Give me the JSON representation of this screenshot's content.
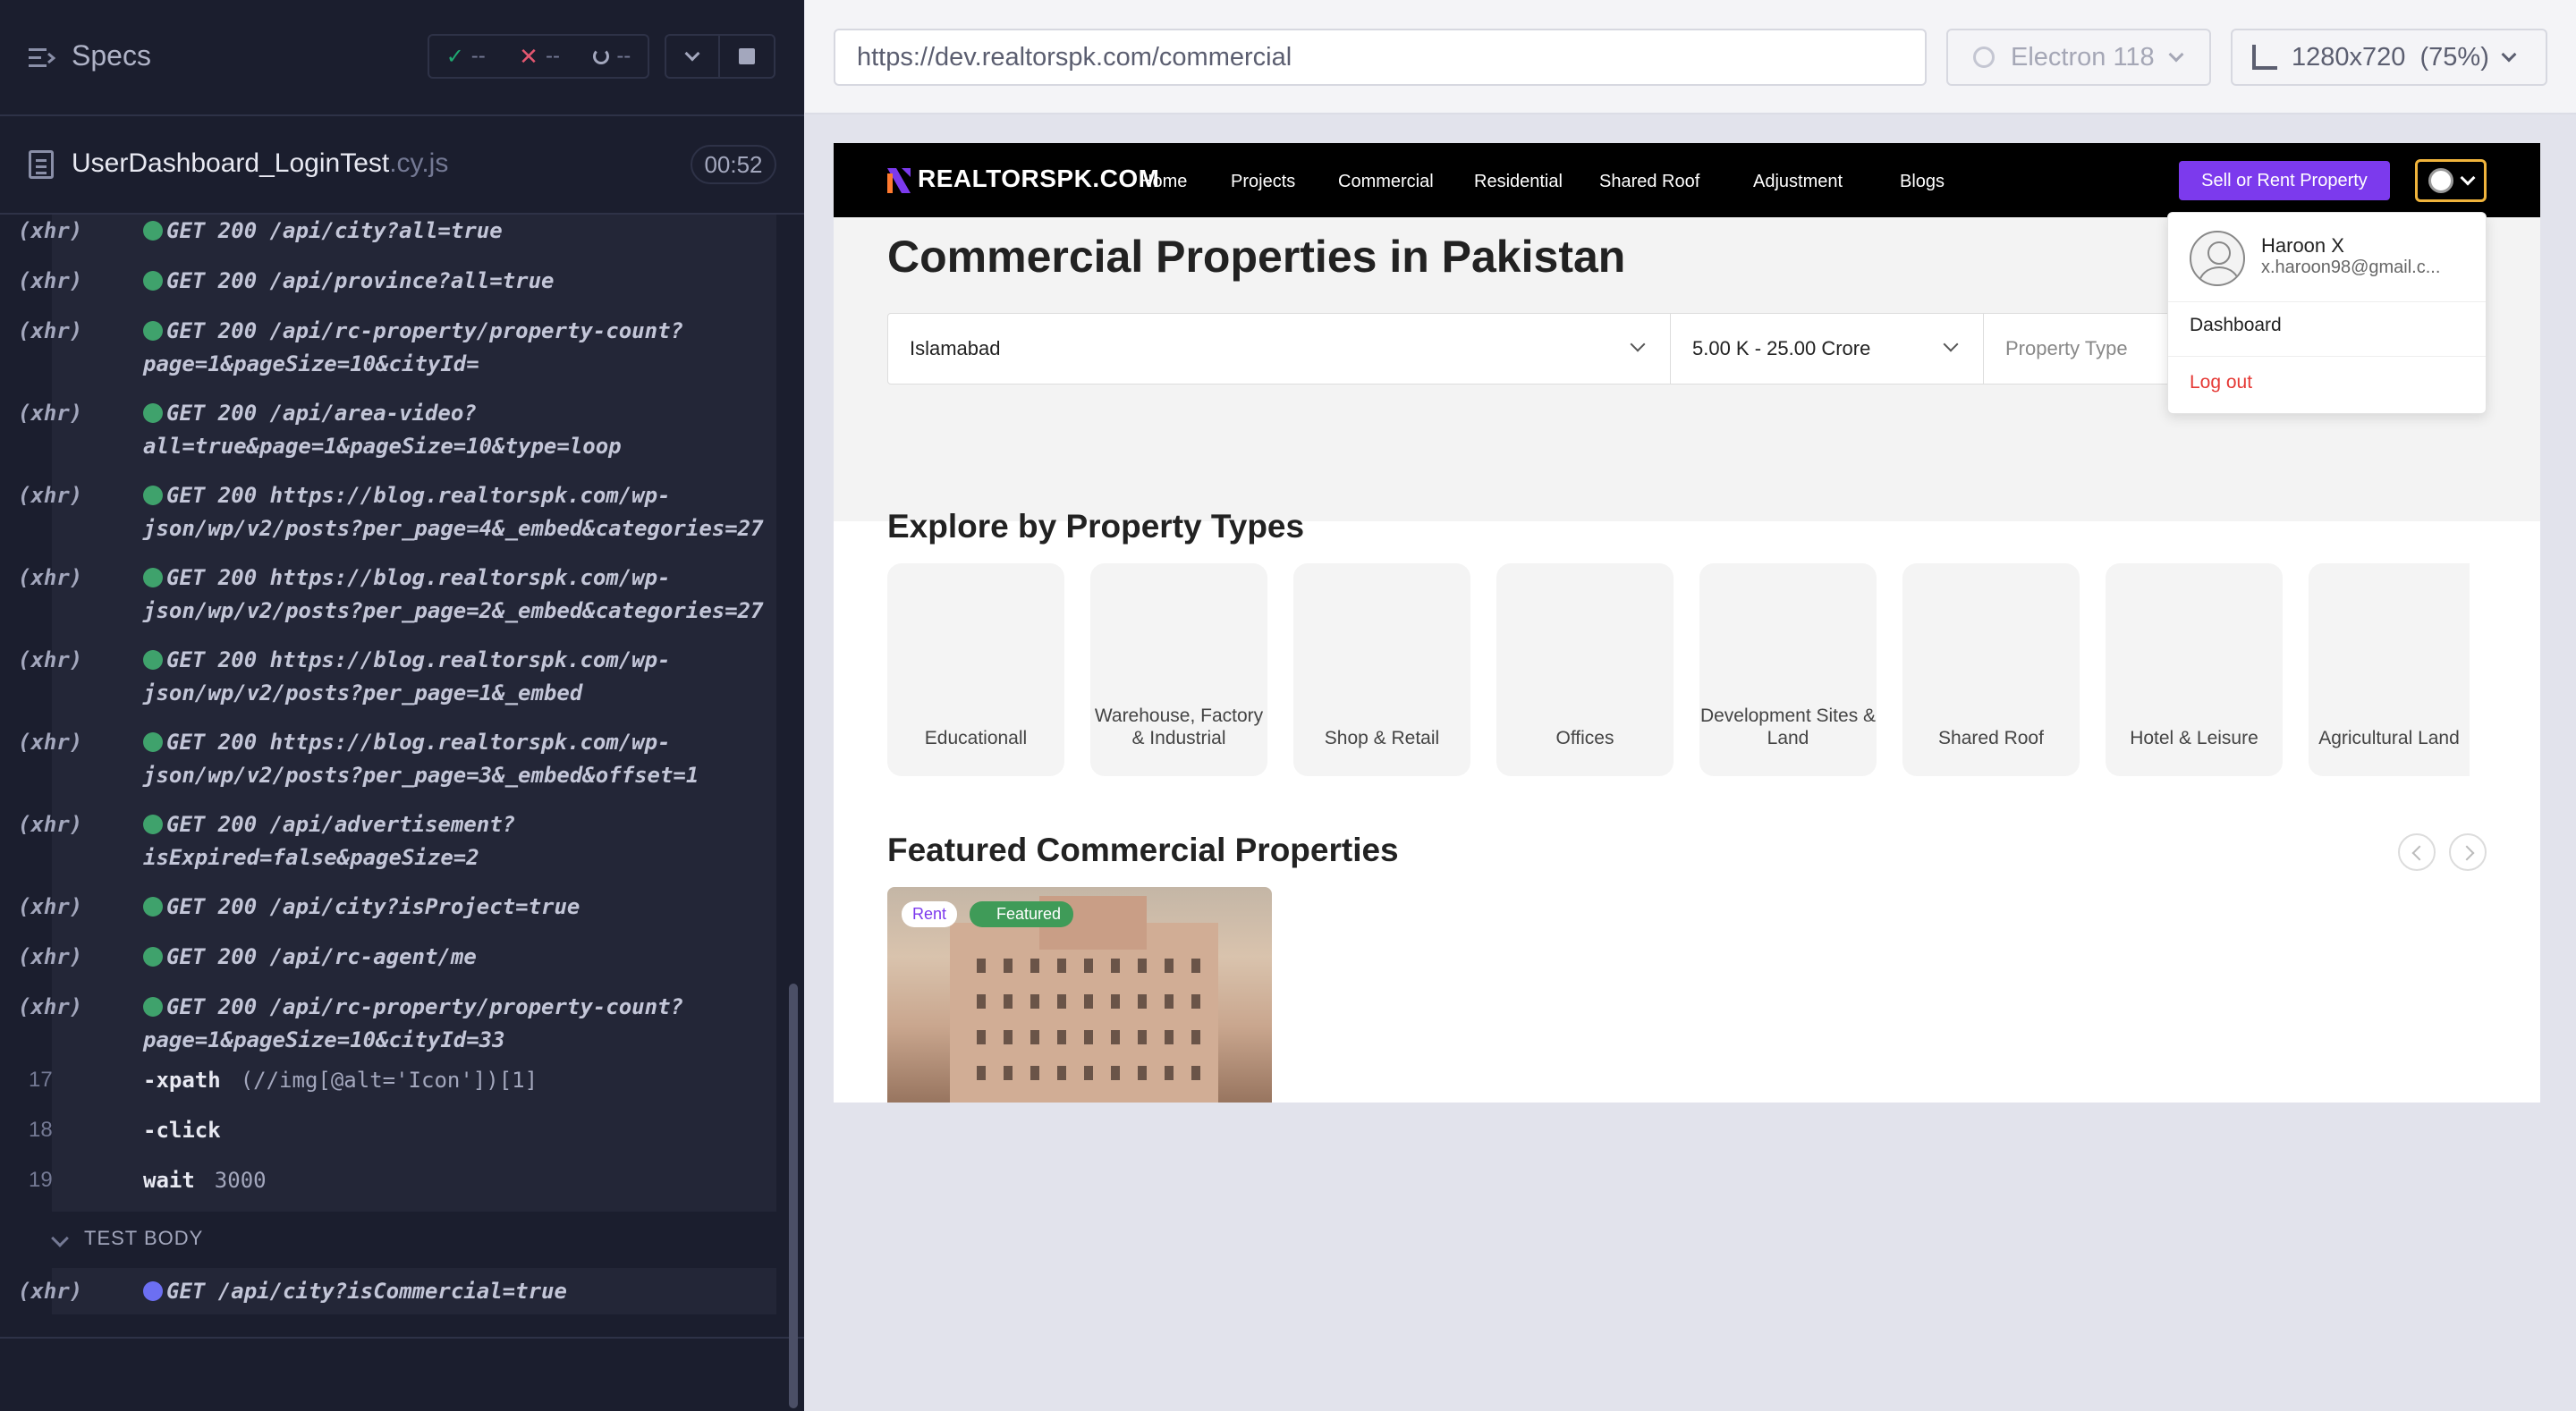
{
  "runner": {
    "header": {
      "title": "Specs",
      "passed": "--",
      "failed": "--",
      "pending": "--"
    },
    "spec": {
      "name": "UserDashboard_LoginTest",
      "ext": ".cy.js",
      "duration": "00:52"
    },
    "log": [
      {
        "tag": "(xhr)",
        "text": "GET 200 /api/city?all=true",
        "status": "success"
      },
      {
        "tag": "(xhr)",
        "text": "GET 200 /api/province?all=true",
        "status": "success"
      },
      {
        "tag": "(xhr)",
        "text": "GET 200 /api/rc-property/property-count?page=1&pageSize=10&cityId=",
        "status": "success"
      },
      {
        "tag": "(xhr)",
        "text": "GET 200 /api/area-video?all=true&page=1&pageSize=10&type=loop",
        "status": "success"
      },
      {
        "tag": "(xhr)",
        "text": "GET 200 https://blog.realtorspk.com/wp-json/wp/v2/posts?per_page=4&_embed&categories=27",
        "status": "success"
      },
      {
        "tag": "(xhr)",
        "text": "GET 200 https://blog.realtorspk.com/wp-json/wp/v2/posts?per_page=2&_embed&categories=27",
        "status": "success"
      },
      {
        "tag": "(xhr)",
        "text": "GET 200 https://blog.realtorspk.com/wp-json/wp/v2/posts?per_page=1&_embed",
        "status": "success"
      },
      {
        "tag": "(xhr)",
        "text": "GET 200 https://blog.realtorspk.com/wp-json/wp/v2/posts?per_page=3&_embed&offset=1",
        "status": "success"
      },
      {
        "tag": "(xhr)",
        "text": "GET 200 /api/advertisement?isExpired=false&pageSize=2",
        "status": "success"
      },
      {
        "tag": "(xhr)",
        "text": "GET 200 /api/city?isProject=true",
        "status": "success"
      },
      {
        "tag": "(xhr)",
        "text": "GET 200 /api/rc-agent/me",
        "status": "success"
      },
      {
        "tag": "(xhr)",
        "text": "GET 200 /api/rc-property/property-count?page=1&pageSize=10&cityId=33",
        "status": "success"
      }
    ],
    "commands": [
      {
        "num": "17",
        "name": "-xpath",
        "arg": "(//img[@alt='Icon'])[1]"
      },
      {
        "num": "18",
        "name": "-click",
        "arg": ""
      },
      {
        "num": "19",
        "name": "wait",
        "arg": "3000"
      }
    ],
    "test_body_label": "TEST BODY",
    "test_body_xhr": {
      "tag": "(xhr)",
      "text": "GET /api/city?isCommercial=true",
      "status": "pending"
    }
  },
  "aut_bar": {
    "url": "https://dev.realtorspk.com/commercial",
    "browser": "Electron 118",
    "viewport": "1280x720  (75%)"
  },
  "site": {
    "logo": "REALTORSPK.COM",
    "nav": [
      "Home",
      "Projects",
      "Commercial",
      "Residential",
      "Shared Roof",
      "Adjustment",
      "Blogs"
    ],
    "sell_button": "Sell or Rent Property",
    "page_title": "Commercial Properties in Pakistan",
    "filters": {
      "city": "Islamabad",
      "price": "5.00 K - 25.00 Crore",
      "property_type_placeholder": "Property Type"
    },
    "explore_title": "Explore by Property Types",
    "property_types": [
      "Educationall",
      "Warehouse, Factory & Industrial",
      "Shop & Retail",
      "Offices",
      "Development Sites & Land",
      "Shared Roof",
      "Hotel & Leisure",
      "Agricultural Land"
    ],
    "featured_title": "Featured Commercial Properties",
    "card": {
      "badge_type": "Rent",
      "badge_featured": "Featured"
    },
    "user_menu": {
      "name": "Haroon X",
      "email": "x.haroon98@gmail.c...",
      "dashboard": "Dashboard",
      "logout": "Log out"
    }
  },
  "colors": {
    "runner_bg": "#1b1e2e",
    "success_dot": "#3fa26c",
    "pending_dot": "#6c6ff2",
    "brand_purple": "#7c3aed",
    "logout_red": "#e53935"
  }
}
